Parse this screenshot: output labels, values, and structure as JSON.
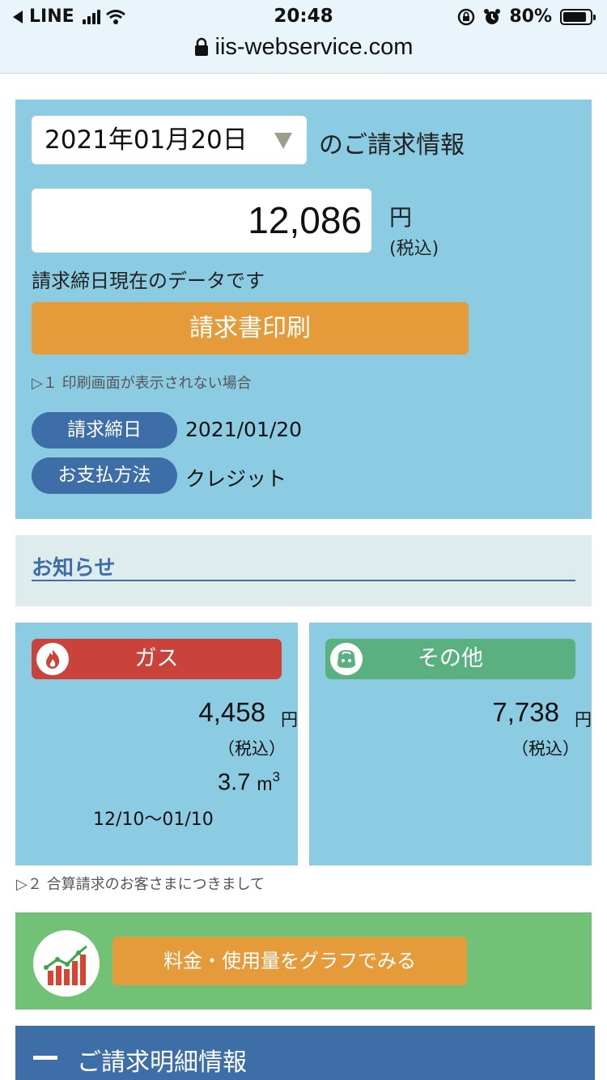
{
  "status_bar": {
    "app": "LINE",
    "time": "20:48",
    "battery": "80%",
    "url": "iis-webservice.com"
  },
  "billing": {
    "date_selected": "2021年01月20日",
    "title": "のご請求情報",
    "amount": "12,086",
    "yen": "円",
    "tax": "(税込)",
    "note": "請求締日現在のデータです",
    "print_button": "請求書印刷",
    "help_link": "▷１ 印刷画面が表示されない場合",
    "closing_label": "請求締日",
    "closing_value": "2021/01/20",
    "payment_label": "お支払方法",
    "payment_value": "クレジット"
  },
  "notice": {
    "title": "お知らせ"
  },
  "cards": {
    "gas": {
      "title": "ガス",
      "amount": "4,458",
      "yen": "円",
      "tax": "（税込）",
      "volume": "3.7",
      "unit": "m",
      "unit_sup": "3",
      "period": "12/10〜01/10"
    },
    "other": {
      "title": "その他",
      "amount": "7,738",
      "yen": "円",
      "tax": "（税込）"
    }
  },
  "footnote": "▷２ 合算請求のお客さまにつきまして",
  "graph": {
    "button": "料金・使用量をグラフでみる"
  },
  "detail": {
    "title": "ご請求明細情報"
  },
  "colors": {
    "panel": "#8bcce3",
    "accent_orange": "#e59b3a",
    "tag_blue": "#3d6ea8",
    "gas_red": "#c9433a",
    "other_green": "#5bb080",
    "graph_green": "#71c277"
  },
  "icons": [
    "back-arrow-icon",
    "signal-icon",
    "wifi-icon",
    "rotation-lock-icon",
    "alarm-icon",
    "battery-icon",
    "lock-icon",
    "dropdown-triangle-icon",
    "flame-icon",
    "wallet-icon",
    "chart-icon",
    "minus-icon"
  ]
}
